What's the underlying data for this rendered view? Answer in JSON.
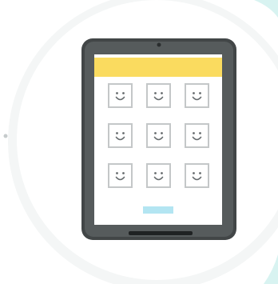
{
  "illustration": {
    "subject": "tablet-face-grid",
    "colors": {
      "background": "#ffffff",
      "outer_circle": "#f4f6f6",
      "inner_circle": "#ffffff",
      "accent_arc": "#d8f3f1",
      "tablet_body": "#424647",
      "tablet_rim": "#565b5c",
      "screen": "#ffffff",
      "header_bar": "#fadb5f",
      "face_frame": "#c4c7c8",
      "face_glyph": "#666b6d",
      "button": "#b3e5f2",
      "camera": "#2a2d2e",
      "home_bar": "#1f2223",
      "dot": "#c6cbcc"
    },
    "face_grid": {
      "rows": 3,
      "cols": 3,
      "icon": "smiley-face-icon"
    }
  }
}
